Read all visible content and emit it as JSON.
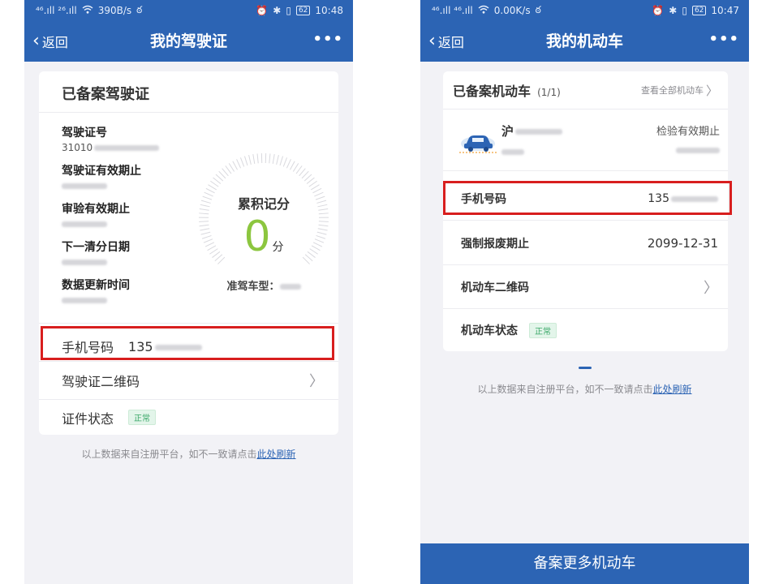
{
  "left": {
    "status": {
      "network": "⁴⁶.ıll ²⁶.ıll",
      "speed": "390B/s",
      "time": "10:48",
      "battery": "62"
    },
    "nav": {
      "back_label": "返回",
      "title": "我的驾驶证",
      "more": "•••"
    },
    "card_title": "已备案驾驶证",
    "fields": [
      {
        "label": "驾驶证号",
        "value": "31010"
      },
      {
        "label": "驾驶证有效期止",
        "value": ""
      },
      {
        "label": "审验有效期止",
        "value": ""
      },
      {
        "label": "下一清分日期",
        "value": ""
      },
      {
        "label": "数据更新时间",
        "value": ""
      }
    ],
    "points": {
      "label": "累积记分",
      "value": "0",
      "unit": "分",
      "vehicle_type_label": "准驾车型："
    },
    "rows": {
      "phone_label": "手机号码",
      "phone_value": "135",
      "qr_label": "驾驶证二维码",
      "status_label": "证件状态",
      "status_badge": "正常"
    },
    "footnote_text": "以上数据来自注册平台，如不一致请点击",
    "footnote_link": "此处刷新"
  },
  "right": {
    "status": {
      "network": "⁴⁶.ıll ⁴⁶.ıll",
      "speed": "0.00K/s",
      "time": "10:47",
      "battery": "62"
    },
    "nav": {
      "back_label": "返回",
      "title": "我的机动车",
      "more": "•••"
    },
    "card_title": "已备案机动车",
    "card_count": "(1/1)",
    "view_all": "查看全部机动车",
    "vehicle": {
      "plate_prefix": "沪",
      "inspection_label": "检验有效期止"
    },
    "rows": {
      "phone_label": "手机号码",
      "phone_value": "135",
      "scrap_label": "强制报废期止",
      "scrap_value": "2099-12-31",
      "qr_label": "机动车二维码",
      "status_label": "机动车状态",
      "status_badge": "正常"
    },
    "footnote_text": "以上数据来自注册平台，如不一致请点击",
    "footnote_link": "此处刷新",
    "bottom_button": "备案更多机动车"
  },
  "colors": {
    "primary": "#2c64b4",
    "highlight": "#d81e1e",
    "points": "#8cc63f",
    "badge": "#3aa868"
  }
}
